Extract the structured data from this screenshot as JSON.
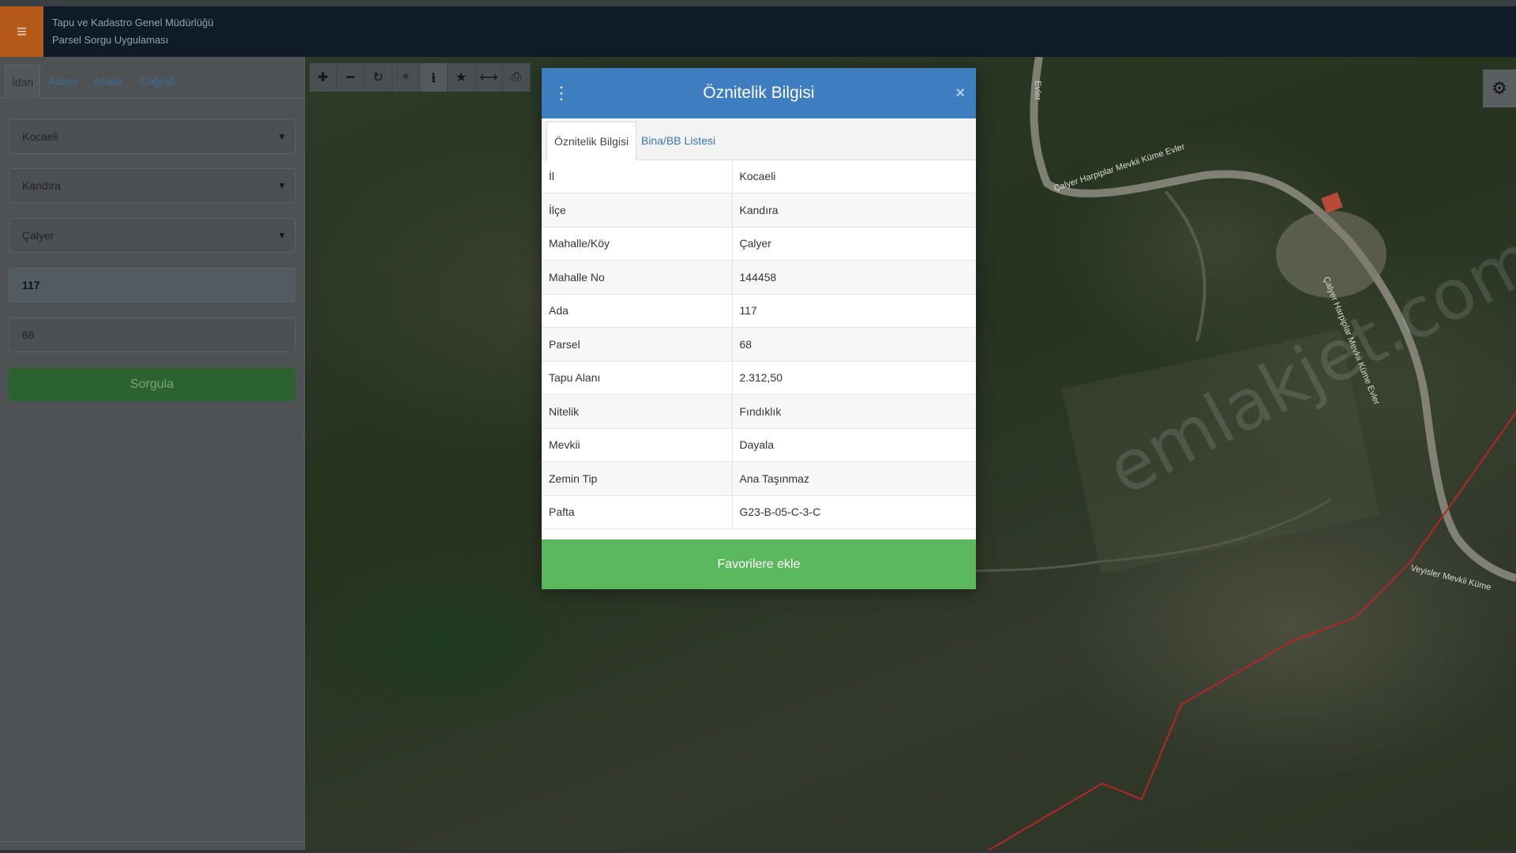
{
  "header": {
    "org_name": "Tapu ve Kadastro Genel Müdürlüğü",
    "app_name": "Parsel Sorgu Uygulaması",
    "menu_icon": "hamburger-icon"
  },
  "sidebar": {
    "tabs": [
      {
        "label": "İdari",
        "active": true
      },
      {
        "label": "Adres",
        "active": false
      },
      {
        "label": "Analiz",
        "active": false
      },
      {
        "label": "Coğrafi",
        "active": false
      }
    ],
    "province": "Kocaeli",
    "district": "Kandıra",
    "neighborhood": "Çalyer",
    "block": "117",
    "parcel": "68",
    "query_label": "Sorgula"
  },
  "map": {
    "toolbar": [
      "plus-icon",
      "minus-icon",
      "refresh-icon",
      "crosshair-icon",
      "info-icon",
      "star-icon",
      "measure-icon",
      "print-icon"
    ],
    "settings_icon": "gear-icon",
    "road_labels": {
      "road_1": "Çalyer Harpiplar Mevkii Küme Evler",
      "road_2": "Çalyer Harpiplar Mevkii Küme Evler",
      "road_3": "Veyisler Mevkii Küme",
      "road_4": "Evler"
    }
  },
  "modal": {
    "title": "Öznitelik Bilgisi",
    "close": "×",
    "tabs": [
      {
        "label": "Öznitelik Bilgisi",
        "active": true
      },
      {
        "label": "Bina/BB Listesi",
        "active": false
      }
    ],
    "rows": [
      {
        "key": "İl",
        "value": "Kocaeli"
      },
      {
        "key": "İlçe",
        "value": "Kandıra"
      },
      {
        "key": "Mahalle/Köy",
        "value": "Çalyer"
      },
      {
        "key": "Mahalle No",
        "value": "144458"
      },
      {
        "key": "Ada",
        "value": "117"
      },
      {
        "key": "Parsel",
        "value": "68"
      },
      {
        "key": "Tapu Alanı",
        "value": "2.312,50"
      },
      {
        "key": "Nitelik",
        "value": "Fındıklık"
      },
      {
        "key": "Mevkii",
        "value": "Dayala"
      },
      {
        "key": "Zemin Tip",
        "value": "Ana Taşınmaz"
      },
      {
        "key": "Pafta",
        "value": "G23-B-05-C-3-C"
      }
    ],
    "favorite_label": "Favorilere ekle"
  },
  "watermark": "emlakjet.com",
  "colors": {
    "header_bg": "#0f1b26",
    "menu_btn": "#b55a19",
    "modal_head": "#3d7dc0",
    "fav_btn": "#5cb85c",
    "query_btn": "#2c6130"
  }
}
